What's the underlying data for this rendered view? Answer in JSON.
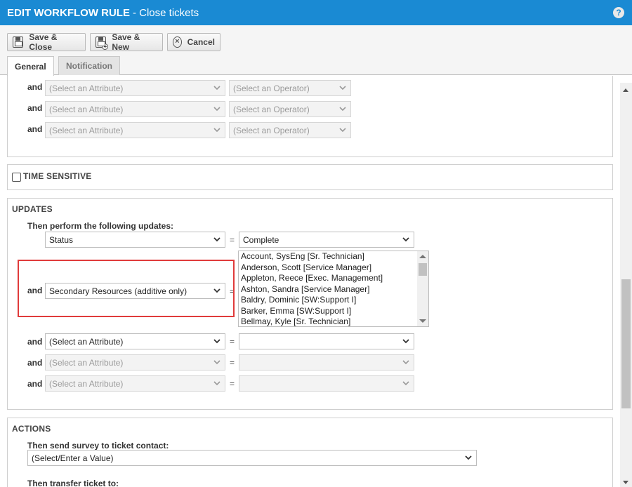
{
  "window": {
    "title_bold": "EDIT WORKFLOW RULE",
    "title_rest": "- Close tickets",
    "help_icon": "?"
  },
  "toolbar": {
    "save_close": "Save & Close",
    "save_new": "Save & New",
    "cancel": "Cancel"
  },
  "tabs": [
    {
      "label": "General",
      "active": true
    },
    {
      "label": "Notification",
      "active": false
    }
  ],
  "conditions": {
    "rows": [
      {
        "and": "and",
        "attribute": "(Select an Attribute)",
        "operator": "(Select an Operator)"
      },
      {
        "and": "and",
        "attribute": "(Select an Attribute)",
        "operator": "(Select an Operator)"
      },
      {
        "and": "and",
        "attribute": "(Select an Attribute)",
        "operator": "(Select an Operator)"
      }
    ]
  },
  "time_sensitive": {
    "label": "TIME SENSITIVE",
    "checked": false
  },
  "updates": {
    "title": "UPDATES",
    "subhead": "Then perform the following updates:",
    "eq": "=",
    "and": "and",
    "row1": {
      "attribute": "Status",
      "value": "Complete"
    },
    "row2": {
      "attribute": "Secondary Resources (additive only)",
      "resources": [
        "Account, SysEng [Sr. Technician]",
        "Anderson, Scott [Service Manager]",
        "Appleton, Reece [Exec. Management]",
        "Ashton, Sandra [Service Manager]",
        "Baldry, Dominic [SW:Support I]",
        "Barker, Emma [SW:Support I]",
        "Bellmay, Kyle [Sr. Technician]"
      ]
    },
    "row3": {
      "attribute": "(Select an Attribute)",
      "value": ""
    },
    "row4": {
      "attribute": "(Select an Attribute)",
      "value": ""
    },
    "row5": {
      "attribute": "(Select an Attribute)",
      "value": ""
    }
  },
  "actions": {
    "title": "ACTIONS",
    "survey_label": "Then send survey to ticket contact:",
    "survey_value": "(Select/Enter a Value)",
    "transfer_label": "Then transfer ticket to:"
  },
  "colors": {
    "title_bar": "#1a8ad3",
    "highlight_border": "#e03b3b"
  }
}
